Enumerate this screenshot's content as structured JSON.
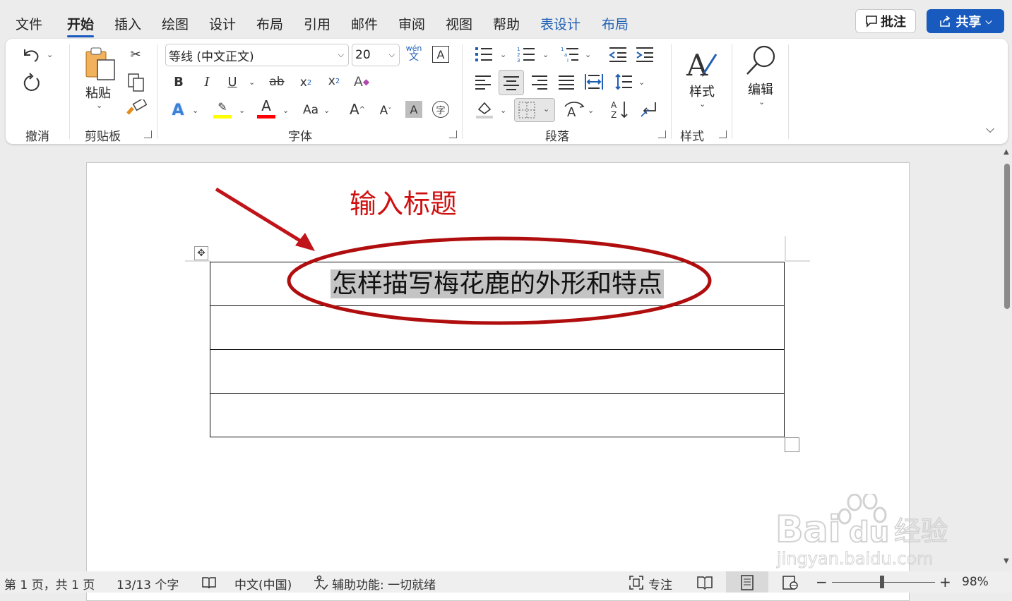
{
  "tabs": [
    "文件",
    "开始",
    "插入",
    "绘图",
    "设计",
    "布局",
    "引用",
    "邮件",
    "审阅",
    "视图",
    "帮助",
    "表设计",
    "布局"
  ],
  "active_tab": "开始",
  "top_buttons": {
    "comment": "批注",
    "share": "共享"
  },
  "ribbon": {
    "groups": {
      "undo": "撤消",
      "clipboard": "剪贴板",
      "font": "字体",
      "paragraph": "段落",
      "styles": "样式"
    },
    "paste_label": "粘贴",
    "font_name": "等线 (中文正文)",
    "font_size": "20",
    "phonetic_top": "wén",
    "phonetic_bottom": "文",
    "styles_label": "样式",
    "edit_label": "编辑"
  },
  "document": {
    "annotation": "输入标题",
    "table_title": "怎样描写梅花鹿的外形和特点",
    "rows": [
      "",
      "",
      ""
    ]
  },
  "statusbar": {
    "page": "第 1 页，共 1 页",
    "words": "13/13 个字",
    "language": "中文(中国)",
    "accessibility": "辅助功能: 一切就绪",
    "focus": "专注",
    "zoom": "98%",
    "zoom_level": 0.98
  },
  "watermark": {
    "brand": "Bai",
    "brand_suffix": "du",
    "cn": "经验",
    "url": "jingyan.baidu.com"
  },
  "colors": {
    "accent": "#185abd",
    "annotation": "#d01010",
    "ellipse": "#b00e0e",
    "highlight": "#ffff00",
    "font_color": "#ff0000"
  }
}
